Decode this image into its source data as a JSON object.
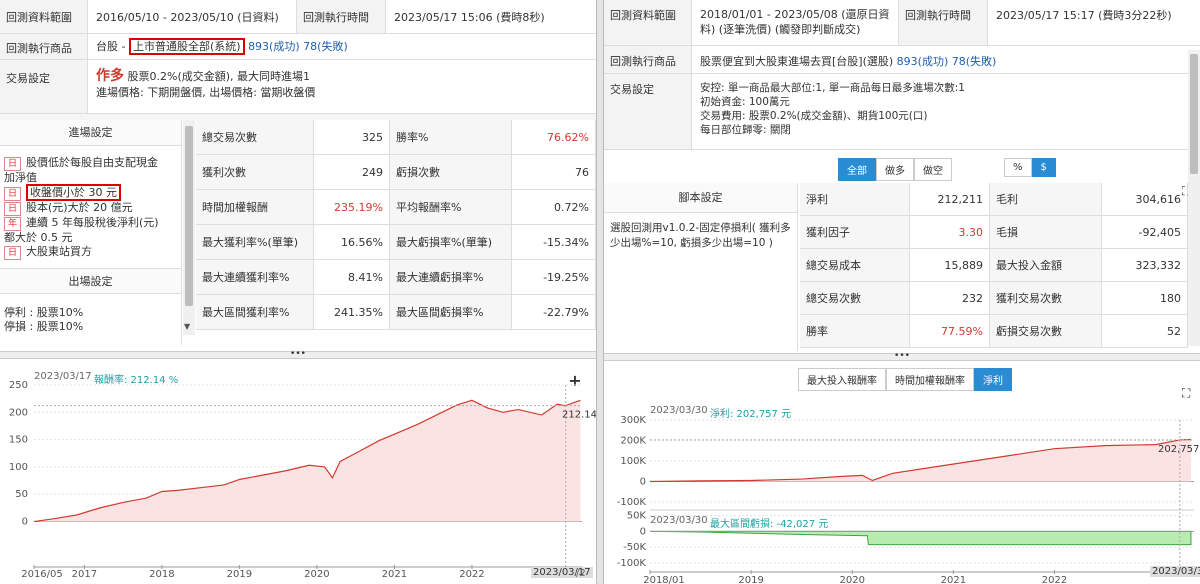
{
  "left": {
    "range_label": "回測資料範圍",
    "range_value": "2016/05/10 - 2023/05/10 (日資料)",
    "exec_time_label": "回測執行時間",
    "exec_time_value": "2023/05/17 15:06 (費時8秒)",
    "product_label": "回測執行商品",
    "product_prefix": "台股 -",
    "product_name": "上市普通股全部(系統)",
    "product_success": "893(成功)",
    "product_fail": "78(失敗)",
    "trade_label": "交易設定",
    "trade_mode": "作多",
    "trade_desc1": "股票0.2%(成交金額), 最大同時進場1",
    "trade_desc2": "進場價格: 下期開盤價, 出場價格: 當期收盤價",
    "entry_title": "進場設定",
    "entry_items": [
      {
        "tag": "日",
        "text": "股價低於每股自由支配現金"
      },
      {
        "tag": "",
        "text": "加淨值"
      },
      {
        "tag": "日",
        "text": "收盤價小於 30 元"
      },
      {
        "tag": "日",
        "text": "股本(元)大於 20 億元"
      },
      {
        "tag": "年",
        "text": "連續 5 年每股稅後淨利(元)"
      },
      {
        "tag": "",
        "text": "都大於 0.5 元"
      },
      {
        "tag": "日",
        "text": "大股東站買方"
      }
    ],
    "exit_title": "出場設定",
    "exit_items": [
      "停利 : 股票10%",
      "停損 : 股票10%"
    ],
    "stats": [
      {
        "l1": "總交易次數",
        "v1": "325",
        "l2": "勝率%",
        "v2": "76.62%",
        "r1": false,
        "r2": true
      },
      {
        "l1": "獲利次數",
        "v1": "249",
        "l2": "虧損次數",
        "v2": "76",
        "r1": false,
        "r2": false
      },
      {
        "l1": "時間加權報酬",
        "v1": "235.19%",
        "l2": "平均報酬率%",
        "v2": "0.72%",
        "r1": true,
        "r2": false
      },
      {
        "l1": "最大獲利率%(單筆)",
        "v1": "16.56%",
        "l2": "最大虧損率%(單筆)",
        "v2": "-15.34%",
        "r1": false,
        "r2": false
      },
      {
        "l1": "最大連續獲利率%",
        "v1": "8.41%",
        "l2": "最大連續虧損率%",
        "v2": "-19.25%",
        "r1": false,
        "r2": false
      },
      {
        "l1": "最大區間獲利率%",
        "v1": "241.35%",
        "l2": "最大區間虧損率%",
        "v2": "-22.79%",
        "r1": false,
        "r2": false
      }
    ],
    "chart_date": "2023/03/17",
    "chart_metric": "報酬率: 212.14 %",
    "chart_last": "212.14",
    "plus": "+",
    "cursor_date": "2023/03/17",
    "x_end": "/2"
  },
  "right": {
    "range_label": "回測資料範圍",
    "range_value": "2018/01/01 - 2023/05/08 (還原日資料) (逐筆洗價) (觸發即判斷成交)",
    "exec_time_label": "回測執行時間",
    "exec_time_value": "2023/05/17 15:17 (費時3分22秒)",
    "product_label": "回測執行商品",
    "product_name": "股票便宜到大股東進場去買[台股](選股)",
    "product_success": "893(成功)",
    "product_fail": "78(失敗)",
    "trade_label": "交易設定",
    "trade_lines": [
      "安控: 單一商品最大部位:1, 單一商品每日最多進場次數:1",
      "初始資金: 100萬元",
      "交易費用: 股票0.2%(成交金額)、期貨100元(口)",
      "每日部位歸零: 關閉"
    ],
    "dir_buttons": [
      "全部",
      "做多",
      "做空"
    ],
    "unit_buttons": [
      "%",
      "$"
    ],
    "script_title": "腳本設定",
    "script_desc": "選股回測用v1.0.2-固定停損利( 獲利多少出場%=10, 虧損多少出場=10 )",
    "stats": [
      {
        "l1": "淨利",
        "v1": "212,211",
        "l2": "毛利",
        "v2": "304,616",
        "r1": false,
        "r2": false
      },
      {
        "l1": "獲利因子",
        "v1": "3.30",
        "l2": "毛損",
        "v2": "-92,405",
        "r1": true,
        "r2": false
      },
      {
        "l1": "總交易成本",
        "v1": "15,889",
        "l2": "最大投入金額",
        "v2": "323,332",
        "r1": false,
        "r2": false
      },
      {
        "l1": "總交易次數",
        "v1": "232",
        "l2": "獲利交易次數",
        "v2": "180",
        "r1": false,
        "r2": false
      },
      {
        "l1": "勝率",
        "v1": "77.59%",
        "l2": "虧損交易次數",
        "v2": "52",
        "r1": true,
        "r2": false
      }
    ],
    "chart_tabs": [
      "最大投入報酬率",
      "時間加權報酬率",
      "淨利"
    ],
    "chart_date": "2023/03/30",
    "chart_metric": "淨利: 202,757 元",
    "chart_last": "202,757",
    "dd_date": "2023/03/30",
    "dd_metric": "最大區間虧損: -42,027 元",
    "cursor_date": "2023/03/30"
  },
  "chart_data": [
    {
      "type": "line",
      "title": "報酬率: 212.14 %",
      "x_ticks": [
        "2016/05",
        "2017",
        "2018",
        "2019",
        "2020",
        "2021",
        "2022"
      ],
      "y_ticks": [
        0,
        50,
        100,
        150,
        200,
        250
      ],
      "ylim": [
        -10,
        250
      ],
      "x": [
        2016.35,
        2016.6,
        2016.9,
        2017.2,
        2017.5,
        2017.8,
        2018.0,
        2018.2,
        2018.5,
        2018.8,
        2019.0,
        2019.3,
        2019.6,
        2019.9,
        2020.1,
        2020.2,
        2020.3,
        2020.5,
        2020.8,
        2021.0,
        2021.3,
        2021.5,
        2021.8,
        2022.0,
        2022.2,
        2022.4,
        2022.6,
        2022.9,
        2023.1,
        2023.2,
        2023.4
      ],
      "values": [
        0,
        5,
        12,
        25,
        35,
        43,
        55,
        57,
        62,
        67,
        77,
        85,
        93,
        103,
        100,
        80,
        110,
        125,
        148,
        160,
        178,
        192,
        213,
        222,
        208,
        200,
        205,
        195,
        215,
        212,
        222
      ]
    },
    {
      "type": "line",
      "title": "淨利: 202,757 元",
      "x_ticks": [
        "2018/01",
        "2019",
        "2020",
        "2021",
        "2022",
        "2023/03/30"
      ],
      "y_ticks": [
        "300K",
        "200K",
        "100K",
        "0",
        "-100K"
      ],
      "ylim": [
        -120000,
        310000
      ],
      "x": [
        2018.0,
        2018.5,
        2019.0,
        2019.5,
        2019.9,
        2020.1,
        2020.2,
        2020.4,
        2020.8,
        2021.2,
        2021.6,
        2022.0,
        2022.5,
        2023.0,
        2023.24,
        2023.35
      ],
      "values": [
        0,
        3000,
        5000,
        12000,
        25000,
        30000,
        5000,
        40000,
        70000,
        100000,
        130000,
        160000,
        175000,
        180000,
        202757,
        205000
      ]
    },
    {
      "type": "area",
      "title": "最大區間虧損: -42,027 元",
      "y_ticks": [
        "50K",
        "0",
        "-50K",
        "-100K"
      ],
      "ylim": [
        -110000,
        55000
      ],
      "x": [
        2018.0,
        2018.5,
        2019.0,
        2019.5,
        2020.15,
        2020.16,
        2023.35
      ],
      "values": [
        0,
        -2000,
        -6000,
        -10000,
        -14000,
        -42027,
        -42027
      ]
    }
  ]
}
